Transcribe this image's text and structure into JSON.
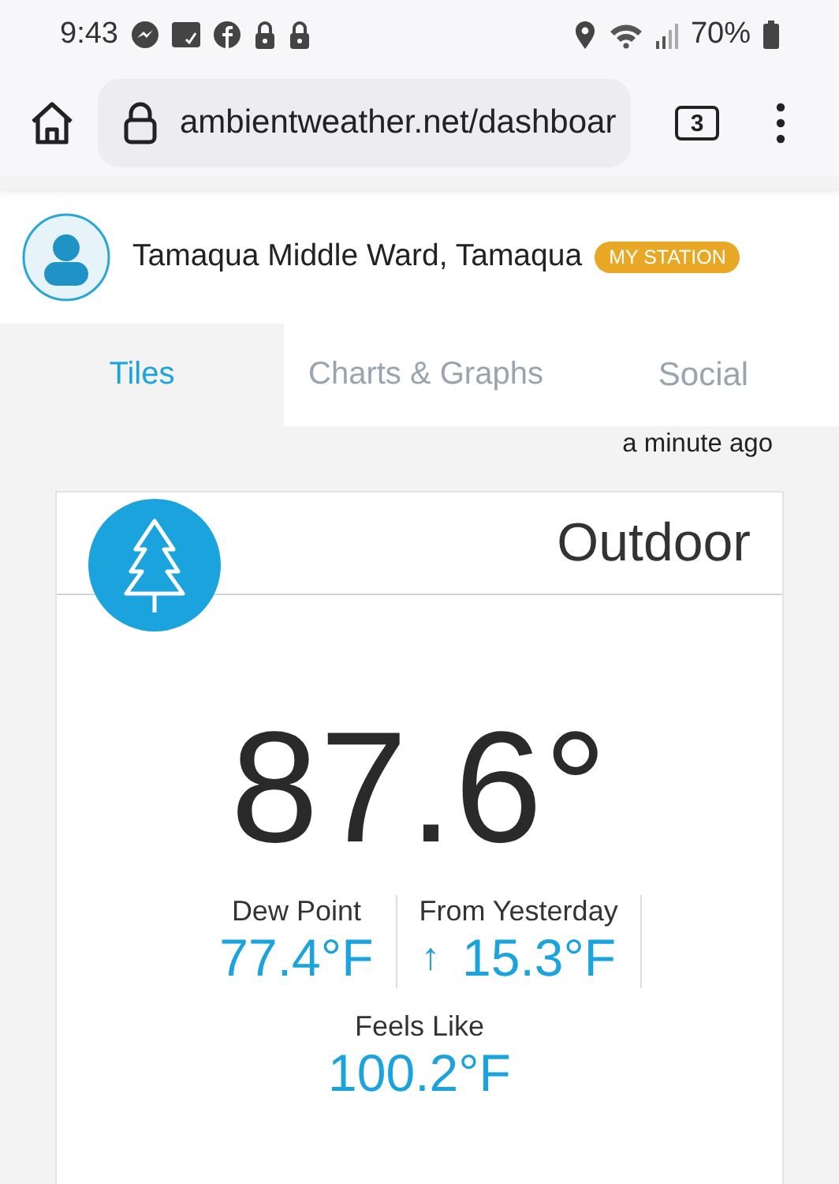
{
  "status_bar": {
    "time": "9:43",
    "battery": "70%"
  },
  "browser": {
    "url": "ambientweather.net/dashboar",
    "tab_count": "3"
  },
  "station": {
    "name": "Tamaqua Middle Ward, Tamaqua",
    "badge": "MY STATION"
  },
  "tabs": [
    {
      "label": "Tiles",
      "selected": true
    },
    {
      "label": "Charts & Graphs",
      "selected": false
    },
    {
      "label": "Social",
      "selected": false
    }
  ],
  "updated": "a minute ago",
  "tile": {
    "title": "Outdoor",
    "temperature": "87.6°",
    "stats": [
      {
        "label": "Dew Point",
        "value": "77.4°F"
      },
      {
        "label": "From Yesterday",
        "arrow": "↑",
        "value": "15.3°F"
      },
      {
        "label": "Feels Like",
        "value": "100.2°F"
      }
    ]
  }
}
